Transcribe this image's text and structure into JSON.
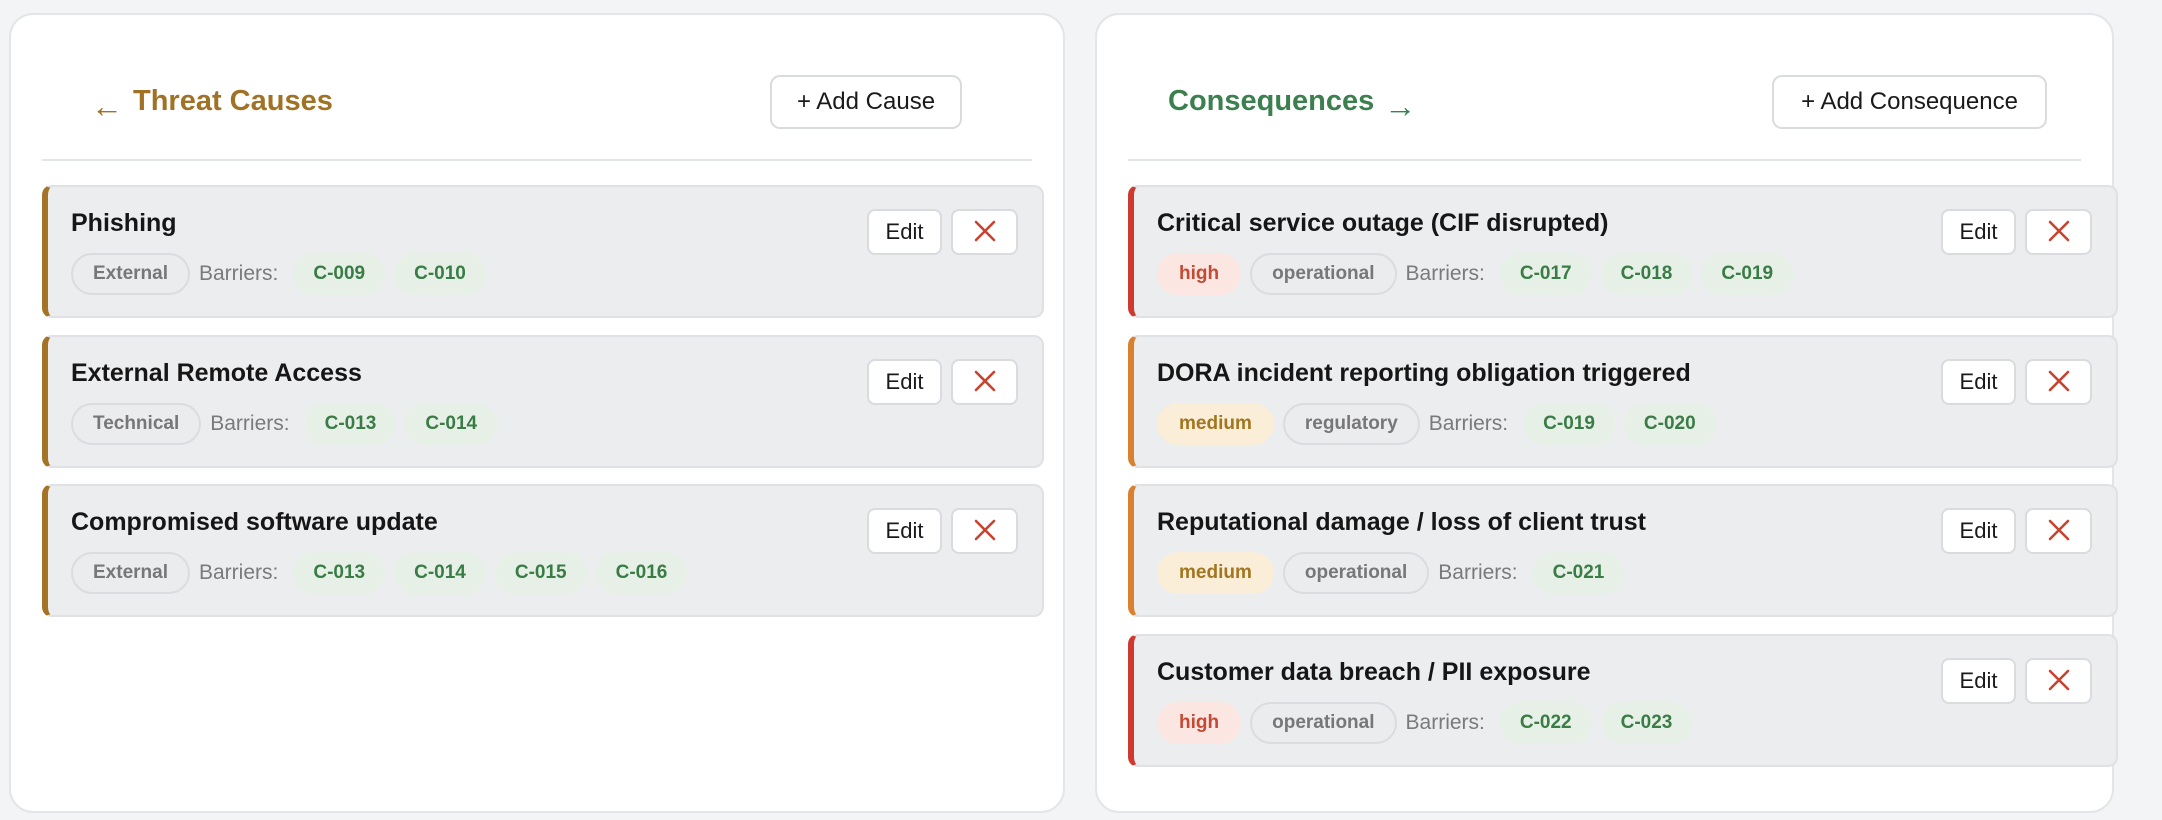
{
  "causes": {
    "title": "Threat Causes",
    "arrow_icon": "←",
    "add_label": "+ Add Cause",
    "accent": "#a07225",
    "barriers_label": "Barriers:",
    "edit_label": "Edit",
    "items": [
      {
        "title": "Phishing",
        "type": "External",
        "barriers": [
          "C-009",
          "C-010"
        ]
      },
      {
        "title": "External Remote Access",
        "type": "Technical",
        "barriers": [
          "C-013",
          "C-014"
        ]
      },
      {
        "title": "Compromised software update",
        "type": "External",
        "barriers": [
          "C-013",
          "C-014",
          "C-015",
          "C-016"
        ]
      }
    ]
  },
  "consequences": {
    "title": "Consequences",
    "arrow_icon": "→",
    "add_label": "+ Add Consequence",
    "accent": "#3d8050",
    "barriers_label": "Barriers:",
    "edit_label": "Edit",
    "items": [
      {
        "title": "Critical service outage (CIF disrupted)",
        "severity": "high",
        "type": "operational",
        "barriers": [
          "C-017",
          "C-018",
          "C-019"
        ]
      },
      {
        "title": "DORA incident reporting obligation triggered",
        "severity": "medium",
        "type": "regulatory",
        "barriers": [
          "C-019",
          "C-020"
        ]
      },
      {
        "title": "Reputational damage / loss of client trust",
        "severity": "medium",
        "type": "operational",
        "barriers": [
          "C-021"
        ]
      },
      {
        "title": "Customer data breach / PII exposure",
        "severity": "high",
        "type": "operational",
        "barriers": [
          "C-022",
          "C-023"
        ]
      }
    ]
  },
  "colors": {
    "cause_border": "#a47325",
    "high_border": "#cf3a30",
    "medium_border": "#d9812f",
    "delete_icon": "#c8432f"
  }
}
